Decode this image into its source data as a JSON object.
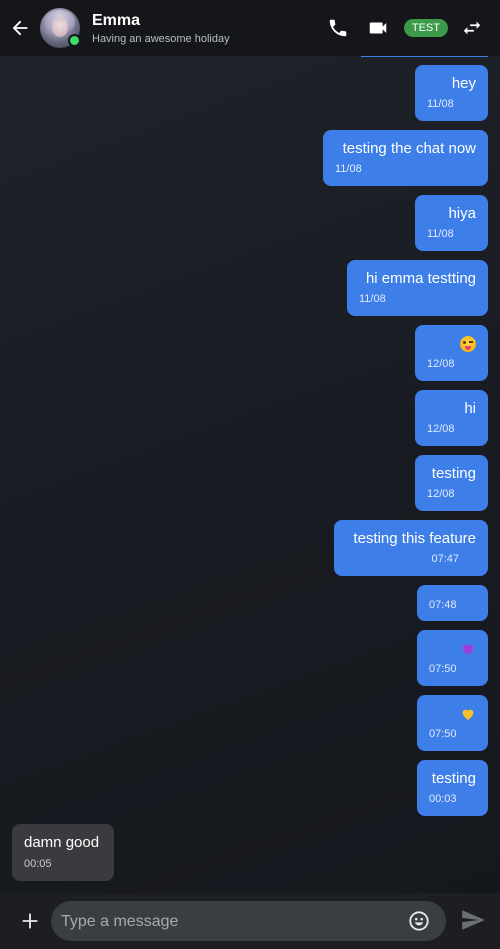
{
  "header": {
    "name": "Emma",
    "status": "Having an awesome holiday",
    "badge": "TEST"
  },
  "messages": [
    {
      "dir": "out",
      "text": "hey",
      "time": "11/08"
    },
    {
      "dir": "out",
      "text": "testing the chat now",
      "time": "11/08"
    },
    {
      "dir": "out",
      "text": "hiya",
      "time": "11/08"
    },
    {
      "dir": "out",
      "text": "hi emma testting",
      "time": "11/08"
    },
    {
      "dir": "out",
      "text": "",
      "emoji": "winking-tongue-emoji",
      "time": "12/08"
    },
    {
      "dir": "out",
      "text": "hi",
      "time": "12/08"
    },
    {
      "dir": "out",
      "text": "testing",
      "time": "12/08"
    },
    {
      "dir": "out",
      "text": "testing this feature",
      "time": "07:47"
    },
    {
      "dir": "out",
      "text": "",
      "time": "07:48"
    },
    {
      "dir": "out",
      "text": "",
      "emoji": "purple-heart-emoji",
      "time": "07:50"
    },
    {
      "dir": "out",
      "text": "",
      "emoji": "yellow-heart-emoji",
      "time": "07:50"
    },
    {
      "dir": "out",
      "text": "testing",
      "time": "00:03"
    },
    {
      "dir": "in",
      "text": "damn good",
      "time": "00:05"
    }
  ],
  "composer": {
    "placeholder": "Type a message"
  },
  "colors": {
    "outgoing_bubble": "#3d7ee8",
    "incoming_bubble": "#3a3b3e",
    "online": "#3ddc67",
    "badge": "#3c9a4a"
  }
}
